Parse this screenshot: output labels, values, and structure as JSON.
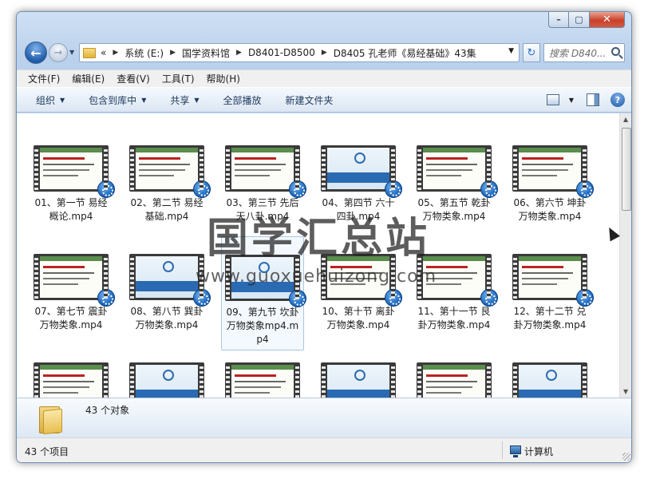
{
  "nav": {
    "breadcrumbs_prefix": "«",
    "breadcrumbs": [
      "系统 (E:)",
      "国学资料馆",
      "D8401-D8500",
      "D8405 孔老师《易经基础》43集"
    ],
    "search_placeholder": "搜索 D840..."
  },
  "menu": [
    "文件(F)",
    "编辑(E)",
    "查看(V)",
    "工具(T)",
    "帮助(H)"
  ],
  "toolbar": {
    "organize": "组织",
    "include_library": "包含到库中",
    "share": "共享",
    "play_all": "全部播放",
    "new_folder": "新建文件夹"
  },
  "files": [
    {
      "name": "01、第一节 易经概论.mp4",
      "style": "text"
    },
    {
      "name": "02、第二节 易经基础.mp4",
      "style": "text"
    },
    {
      "name": "03、第三节 先后天八卦.mp4",
      "style": "text"
    },
    {
      "name": "04、第四节 六十四卦.mp4",
      "style": "blue"
    },
    {
      "name": "05、第五节 乾卦万物类象.mp4",
      "style": "text"
    },
    {
      "name": "06、第六节 坤卦万物类象.mp4",
      "style": "text"
    },
    {
      "name": "07、第七节 震卦万物类象.mp4",
      "style": "text"
    },
    {
      "name": "08、第八节 巽卦万物类象.mp4",
      "style": "blue"
    },
    {
      "name": "09、第九节 坎卦万物类象mp4.mp4",
      "style": "blue",
      "selected": true
    },
    {
      "name": "10、第十节 离卦万物类象.mp4",
      "style": "text"
    },
    {
      "name": "11、第十一节 艮卦万物类象.mp4",
      "style": "text"
    },
    {
      "name": "12、第十二节 兑卦万物类象.mp4",
      "style": "text"
    },
    {
      "name": "",
      "style": "text"
    },
    {
      "name": "",
      "style": "blue"
    },
    {
      "name": "",
      "style": "text"
    },
    {
      "name": "",
      "style": "blue"
    },
    {
      "name": "",
      "style": "text"
    },
    {
      "name": "",
      "style": "blue"
    }
  ],
  "watermark": {
    "cn": "国学汇总站",
    "url": "www.guoxuehuizong.com"
  },
  "details": {
    "count_text": "43 个对象"
  },
  "status": {
    "items_text": "43 个项目",
    "location": "计算机"
  }
}
